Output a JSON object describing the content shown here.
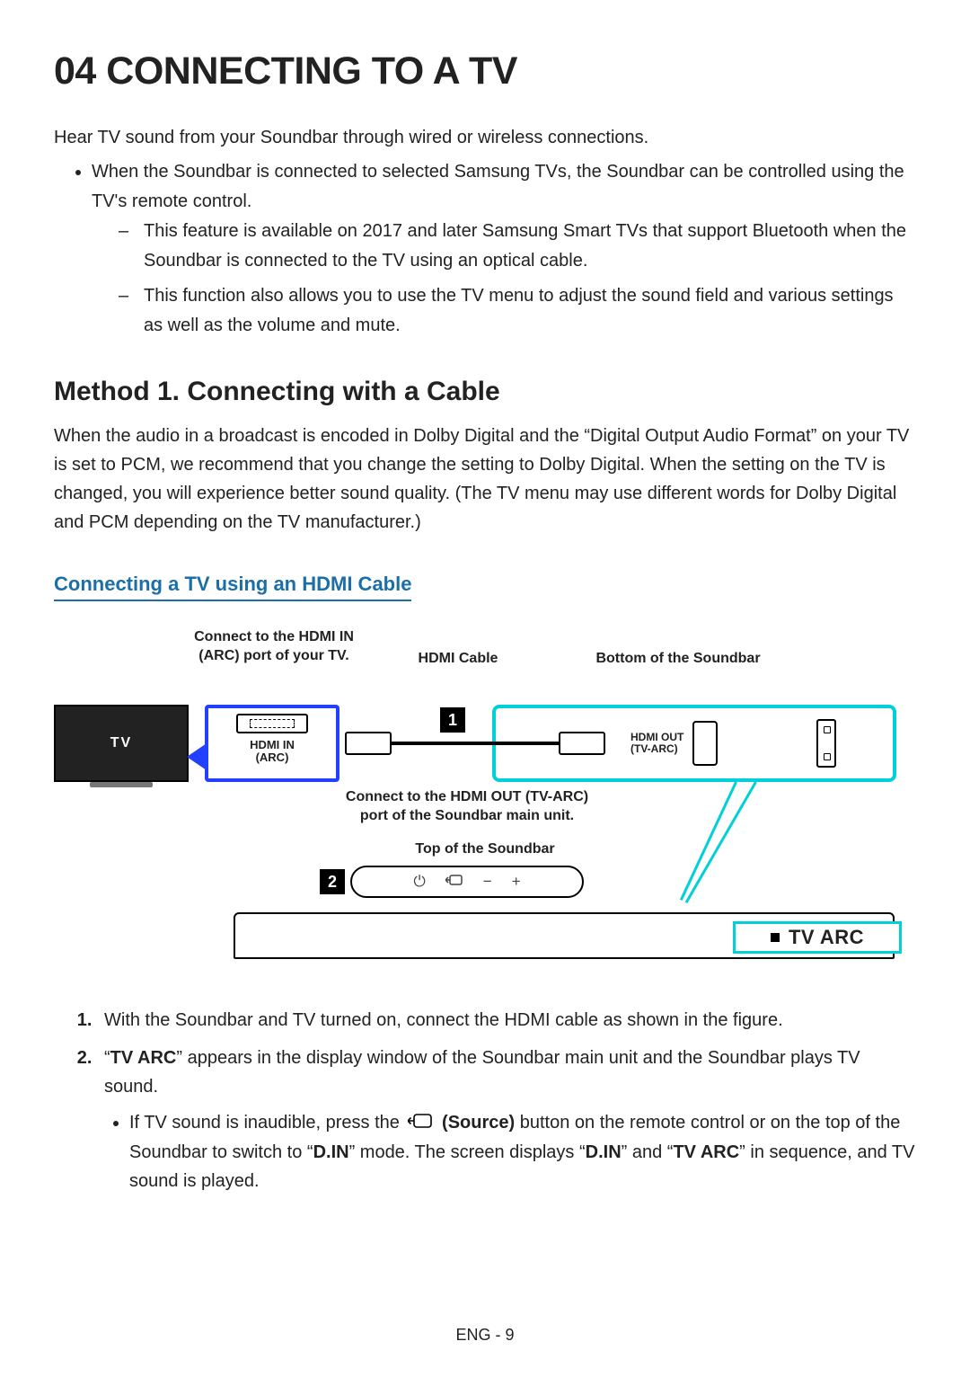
{
  "title": "04  CONNECTING TO A TV",
  "intro": "Hear TV sound from your Soundbar through wired or wireless connections.",
  "bullet1": "When the Soundbar is connected to selected Samsung TVs, the Soundbar can be controlled using the TV's remote control.",
  "dash1": "This feature is available on 2017 and later Samsung Smart TVs that support Bluetooth when the Soundbar is connected to the TV using an optical cable.",
  "dash2": "This function also allows you to use the TV menu to adjust the sound field and various settings as well as the volume and mute.",
  "method_heading": "Method 1. Connecting with a Cable",
  "method_para": "When the audio in a broadcast is encoded in Dolby Digital and the “Digital Output Audio Format” on your TV is set to PCM, we recommend that you change the setting to Dolby Digital. When the setting on the TV is changed, you will experience better sound quality. (The TV menu may use different words for Dolby Digital and PCM depending on the TV manufacturer.)",
  "sub_heading": "Connecting a TV using an HDMI Cable",
  "diagram": {
    "connect_in_line1": "Connect to the HDMI IN",
    "connect_in_line2": "(ARC) port of your TV.",
    "hdmi_cable": "HDMI Cable",
    "bottom_sb": "Bottom of the Soundbar",
    "tv_label": "TV",
    "hdmi_in_line1": "HDMI IN",
    "hdmi_in_line2": "(ARC)",
    "badge1": "1",
    "hdmi_out_line1": "HDMI OUT",
    "hdmi_out_line2": "(TV-ARC)",
    "connect_out_line1": "Connect to the HDMI OUT (TV-ARC)",
    "connect_out_line2": "port of the Soundbar main unit.",
    "top_sb": "Top of the Soundbar",
    "badge2": "2",
    "display_text": "TV ARC"
  },
  "step1": "With the Soundbar and TV turned on, connect the HDMI cable as shown in the figure.",
  "step2_pre": "“",
  "step2_bold1": "TV ARC",
  "step2_post1": "” appears in the display window of the Soundbar main unit and the Soundbar plays TV sound.",
  "step2_sub_pre": "If TV sound is inaudible, press the ",
  "step2_sub_source": "(Source)",
  "step2_sub_mid1": " button on the remote control or on the top of the Soundbar to switch to “",
  "step2_sub_din": "D.IN",
  "step2_sub_mid2": "” mode. The screen displays “",
  "step2_sub_mid3": "” and “",
  "step2_sub_tvarc": "TV ARC",
  "step2_sub_end": "” in sequence, and TV sound is played.",
  "footer": "ENG - 9"
}
